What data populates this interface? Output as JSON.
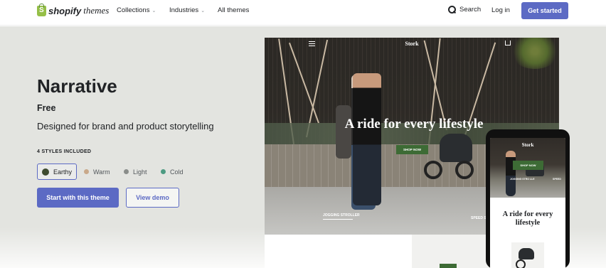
{
  "header": {
    "logo_word": "shopify",
    "logo_sub": "themes",
    "nav": [
      {
        "label": "Collections",
        "has_dropdown": true
      },
      {
        "label": "Industries",
        "has_dropdown": true
      },
      {
        "label": "All themes",
        "has_dropdown": false
      }
    ],
    "search_label": "Search",
    "login_label": "Log in",
    "cta_label": "Get started"
  },
  "theme": {
    "name": "Narrative",
    "price": "Free",
    "tagline": "Designed for brand and product storytelling",
    "styles_label": "4 STYLES INCLUDED",
    "styles": [
      {
        "label": "Earthy",
        "color": "#3d4a2f",
        "selected": true
      },
      {
        "label": "Warm",
        "color": "#c9a98a",
        "selected": false
      },
      {
        "label": "Light",
        "color": "#8a8d8a",
        "selected": false
      },
      {
        "label": "Cold",
        "color": "#4d9b82",
        "selected": false
      }
    ],
    "primary_button": "Start with this theme",
    "secondary_button": "View demo"
  },
  "preview": {
    "desktop": {
      "brand": "Stork",
      "headline": "A ride for every lifestyle",
      "shop_button": "SHOP NOW",
      "caption": "JOGGING STROLLER",
      "speed_label": "SPEED S"
    },
    "mobile": {
      "brand": "Stork",
      "shop_button": "SHOP NOW",
      "chips": [
        "JOGGING STRO LLE",
        "SPEED"
      ],
      "headline": "A ride for every lifestyle"
    }
  },
  "colors": {
    "accent": "#5c6ac4",
    "hero_bg": "#e3e4e0",
    "cta_green": "#3d6b35",
    "brand_green": "#95bf47"
  }
}
